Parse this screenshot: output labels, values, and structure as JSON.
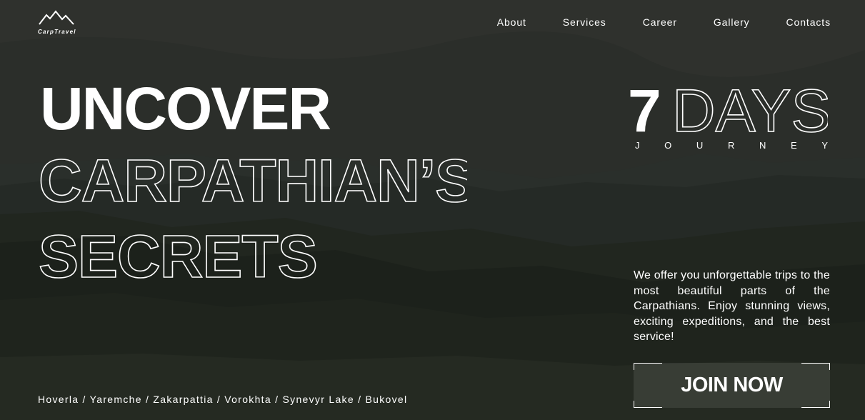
{
  "logo": {
    "text": "CarpTravel"
  },
  "nav": {
    "items": [
      {
        "label": "About"
      },
      {
        "label": "Services"
      },
      {
        "label": "Career"
      },
      {
        "label": "Gallery"
      },
      {
        "label": "Contacts"
      }
    ]
  },
  "hero": {
    "title_bold": "UNCOVER",
    "title_line2": "CARPATHIAN’S",
    "title_line3": "SECRETS",
    "days_number": "7",
    "days_word": "DAYS",
    "journey_letters": [
      "J",
      "O",
      "U",
      "R",
      "N",
      "E",
      "Y"
    ],
    "description": "We offer you unforgettable trips to the most beautiful parts of the Carpathians. Enjoy stunning views, exciting expeditions, and the best service!",
    "join_label": "JOIN NOW",
    "places": "Hoverla / Yaremche / Zakarpattia / Vorokhta / Synevyr Lake / Bukovel"
  },
  "colors": {
    "text": "#ffffff",
    "overlay": "#232723",
    "button_fill": "rgba(255,255,255,0.09)"
  }
}
